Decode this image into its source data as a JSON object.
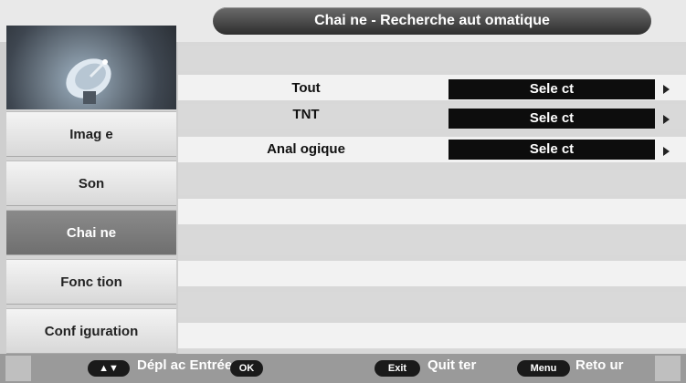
{
  "title": "Chai ne - Recherche aut omatique",
  "sidebar": {
    "items": [
      {
        "label": "Imag e"
      },
      {
        "label": "Son"
      },
      {
        "label": "Chai ne"
      },
      {
        "label": "Fonc tion"
      },
      {
        "label": "Conf iguration"
      }
    ]
  },
  "options": [
    {
      "label": "Tout",
      "value": "Sele ct"
    },
    {
      "label": "TNT",
      "value": "Sele ct"
    },
    {
      "label": "Anal ogique",
      "value": "Sele ct"
    }
  ],
  "help": {
    "nav_key": "▲▼",
    "nav_text": "Dépl ac Entrée",
    "ok_key": "OK",
    "exit_key": "Exit",
    "exit_text": "Quit ter",
    "menu_key": "Menu",
    "menu_text": "Reto ur"
  },
  "colors": {
    "title_bar": "#3a3a3a",
    "selected_nav": "#7a7a7a",
    "value_box": "#0d0d0d"
  }
}
